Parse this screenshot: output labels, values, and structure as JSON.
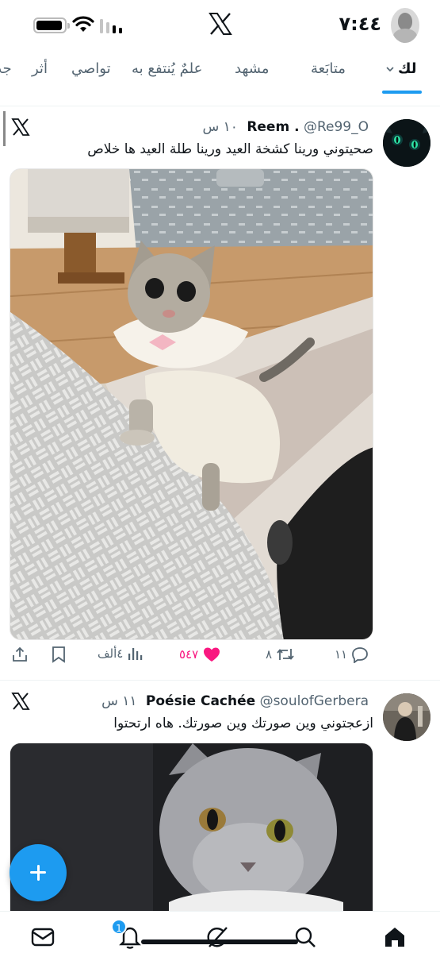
{
  "status_bar": {
    "time": "٧:٤٤",
    "battery_icon": "battery-full-icon",
    "wifi_icon": "wifi-icon",
    "signal_icon": "cellular-signal-icon"
  },
  "app": {
    "logo_icon": "x-logo-icon"
  },
  "tabs": [
    {
      "label": "لك",
      "active": true,
      "has_chevron": true
    },
    {
      "label": "متابَعة"
    },
    {
      "label": "مشهد"
    },
    {
      "label": "علمٌ يُنتفع به"
    },
    {
      "label": "تواصي"
    },
    {
      "label": "أثر"
    },
    {
      "label": "جد"
    }
  ],
  "tweets": [
    {
      "name": "Reem .",
      "handle": "@Re99_O",
      "time": "١٠ س",
      "text": "صحيتوني ورينا كشخة العيد ورينا طلة العيد ها خلاص",
      "media_description_icon": "cat-in-dress-photo",
      "actions": {
        "replies": "١١",
        "reposts": "٨",
        "likes": "٥٤٧",
        "views": "٤ألف"
      }
    },
    {
      "name": "Poésie Cachée",
      "handle": "@soulofGerbera",
      "time": "١١ س",
      "text": "ازعجتوني وين صورتك وين صورتك. هاه ارتحتوا",
      "media_description_icon": "grey-cat-photo"
    }
  ],
  "colors": {
    "accent": "#1d9bf0",
    "like": "#f91880",
    "text_primary": "#0f1419",
    "text_secondary": "#536471"
  },
  "bottom_nav": {
    "items": [
      "messages-icon",
      "notifications-icon",
      "grok-icon",
      "search-icon",
      "home-icon"
    ],
    "notification_badge": "1"
  },
  "fab": {
    "icon": "plus-icon"
  }
}
